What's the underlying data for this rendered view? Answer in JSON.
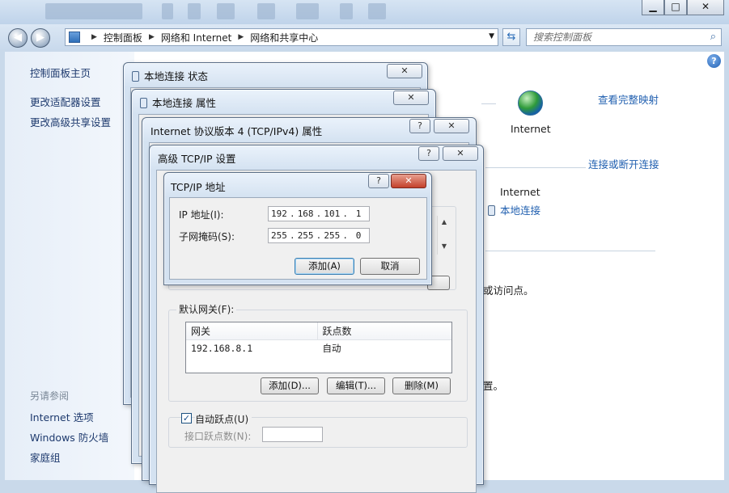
{
  "window": {
    "controls": {
      "minimize": "▁",
      "maximize": "□",
      "close": "✕"
    }
  },
  "address": {
    "crumbs": [
      "控制面板",
      "网络和 Internet",
      "网络和共享中心"
    ],
    "search_placeholder": "搜索控制面板",
    "icons": {
      "back": "back-arrow-icon",
      "forward": "forward-arrow-icon",
      "refresh": "refresh-icon",
      "search": "search-icon"
    }
  },
  "sidebar": {
    "home": "控制面板主页",
    "links": [
      "更改适配器设置",
      "更改高级共享设置"
    ],
    "see_also_title": "另请参阅",
    "see_also": [
      "Internet 选项",
      "Windows 防火墙",
      "家庭组"
    ]
  },
  "main": {
    "help": "?",
    "view_full_map": "查看完整映射",
    "internet_label": "Internet",
    "connect_disconnect": "连接或断开连接",
    "access_type": "Internet",
    "connection_link": "本地连接",
    "partial_text_1": "或访问点。",
    "partial_text_2": "置。"
  },
  "dialogs": {
    "status": {
      "title": "本地连接 状态",
      "close": "✕"
    },
    "properties": {
      "title": "本地连接 属性",
      "close": "✕"
    },
    "ipv4": {
      "title": "Internet 协议版本 4 (TCP/IPv4) 属性",
      "help": "?",
      "close": "✕"
    },
    "advanced": {
      "title": "高级 TCP/IP 设置",
      "help": "?",
      "close": "✕",
      "gateway_group": "默认网关(F):",
      "gateway_columns": [
        "网关",
        "跃点数"
      ],
      "gateway_rows": [
        [
          "192.168.8.1",
          "自动"
        ]
      ],
      "buttons": {
        "add": "添加(D)...",
        "edit": "编辑(T)...",
        "remove": "删除(M)"
      },
      "auto_metric_checked": "✓",
      "auto_metric_label": "自动跃点(U)",
      "interface_metric_label": "接口跃点数(N):"
    },
    "tcpip_address": {
      "title": "TCP/IP 地址",
      "help": "?",
      "close": "✕",
      "ip_label": "IP 地址(I):",
      "ip_octets": [
        "192",
        "168",
        "101",
        "1"
      ],
      "mask_label": "子网掩码(S):",
      "mask_octets": [
        "255",
        "255",
        "255",
        "0"
      ],
      "add_button": "添加(A)",
      "cancel_button": "取消"
    }
  },
  "colors": {
    "link": "#2160b0",
    "title_gradient_top": "#d6e4f3",
    "dialog_frame": "#d4e2f1"
  }
}
